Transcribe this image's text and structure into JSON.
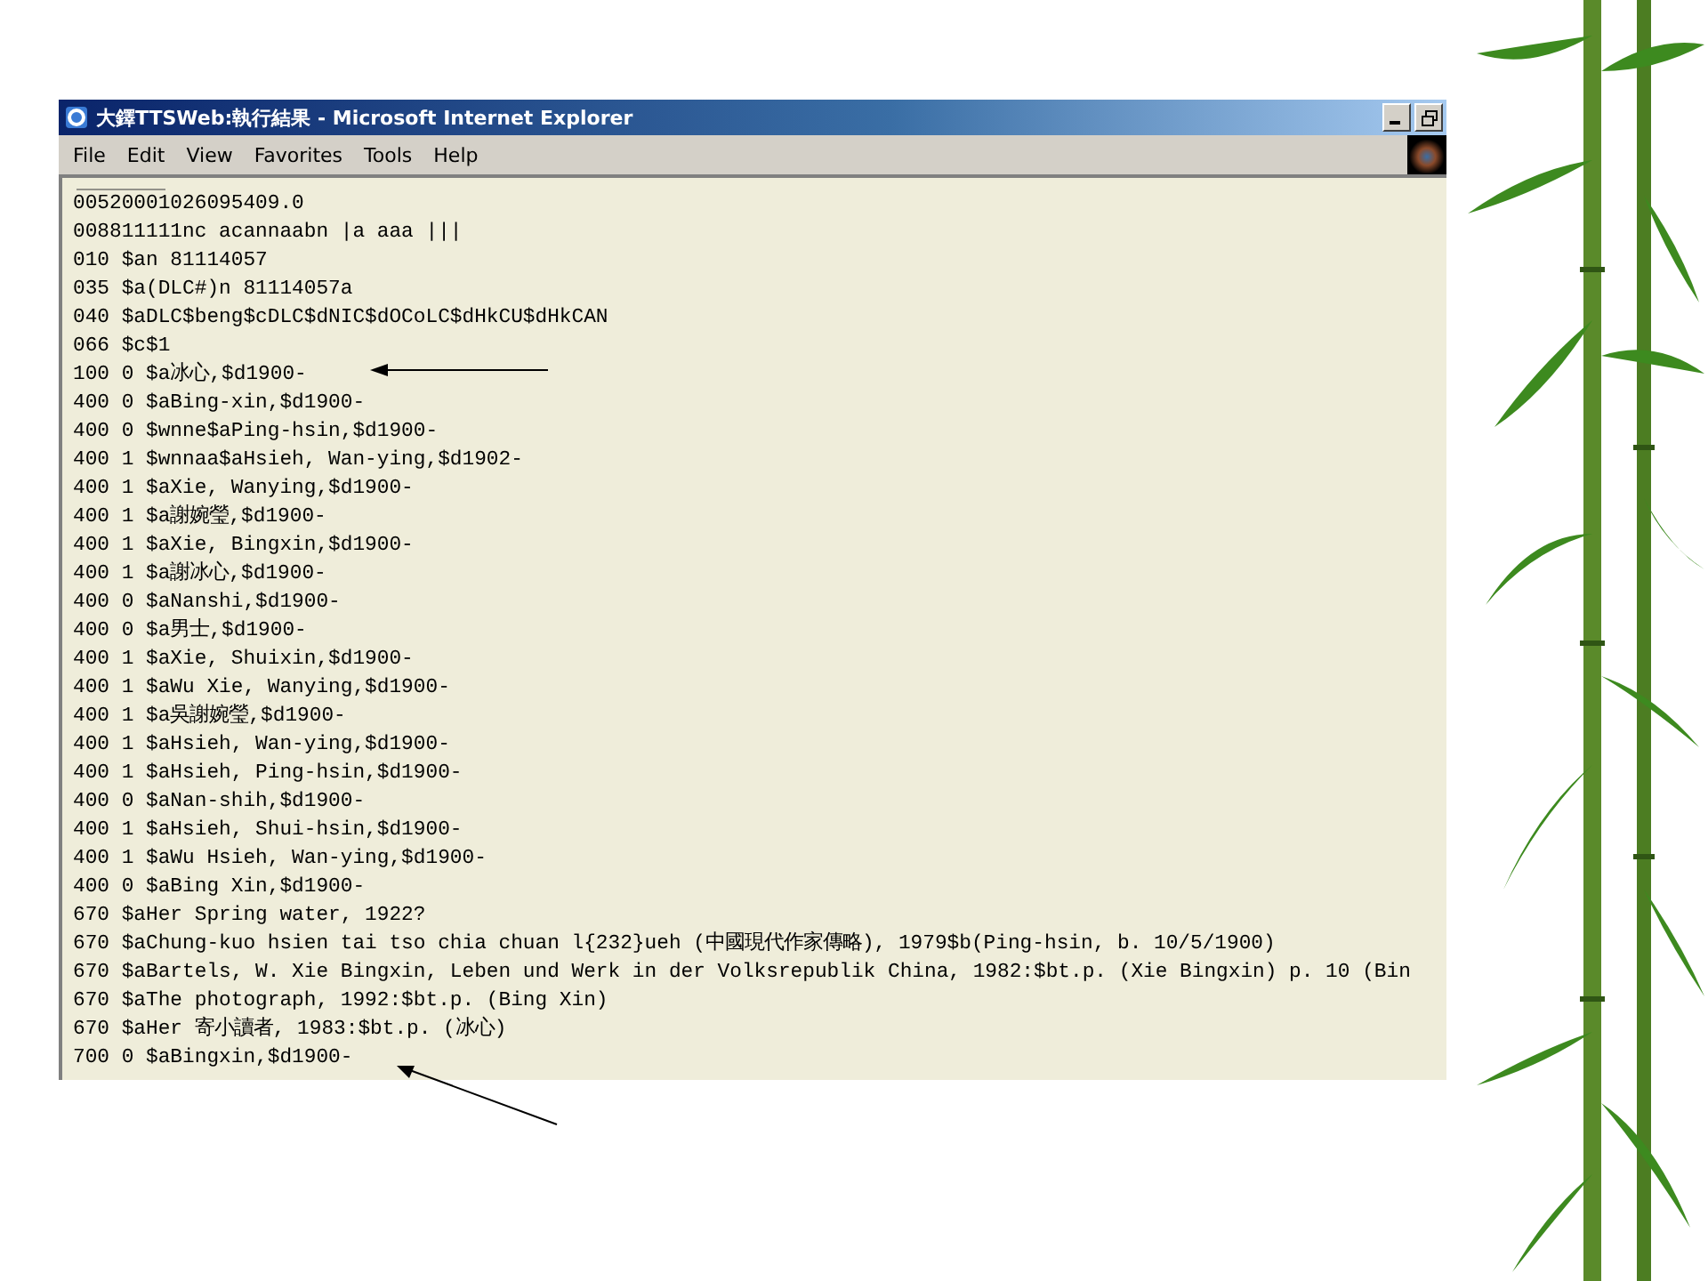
{
  "window": {
    "title": "大鐸TTSWeb:執行結果 - Microsoft Internet Explorer"
  },
  "menu": [
    "File",
    "Edit",
    "View",
    "Favorites",
    "Tools",
    "Help"
  ],
  "lines": [
    "00520001026095409.0",
    "008811111nc acannaabn |a aaa |||",
    "010 $an 81114057",
    "035 $a(DLC#)n 81114057a",
    "040 $aDLC$beng$cDLC$dNIC$dOCoLC$dHkCU$dHkCAN",
    "066 $c$1",
    "100 0 $a冰心,$d1900-",
    "400 0 $aBing-xin,$d1900-",
    "400 0 $wnne$aPing-hsin,$d1900-",
    "400 1 $wnnaa$aHsieh, Wan-ying,$d1902-",
    "400 1 $aXie, Wanying,$d1900-",
    "400 1 $a謝婉瑩,$d1900-",
    "400 1 $aXie, Bingxin,$d1900-",
    "400 1 $a謝冰心,$d1900-",
    "400 0 $aNanshi,$d1900-",
    "400 0 $a男士,$d1900-",
    "400 1 $aXie, Shuixin,$d1900-",
    "400 1 $aWu Xie, Wanying,$d1900-",
    "400 1 $a吳謝婉瑩,$d1900-",
    "400 1 $aHsieh, Wan-ying,$d1900-",
    "400 1 $aHsieh, Ping-hsin,$d1900-",
    "400 0 $aNan-shih,$d1900-",
    "400 1 $aHsieh, Shui-hsin,$d1900-",
    "400 1 $aWu Hsieh, Wan-ying,$d1900-",
    "400 0 $aBing Xin,$d1900-",
    "670 $aHer Spring water, 1922?",
    "670 $aChung-kuo hsien tai tso chia chuan l{232}ueh (中國現代作家傳略), 1979$b(Ping-hsin, b. 10/5/1900)",
    "670 $aBartels, W. Xie Bingxin, Leben und Werk in der Volksrepublik China, 1982:$bt.p. (Xie Bingxin) p. 10 (Bin",
    "670 $aThe photograph, 1992:$bt.p. (Bing Xin)",
    "670 $aHer 寄小讀者, 1983:$bt.p. (冰心)",
    "700 0 $aBingxin,$d1900-"
  ]
}
